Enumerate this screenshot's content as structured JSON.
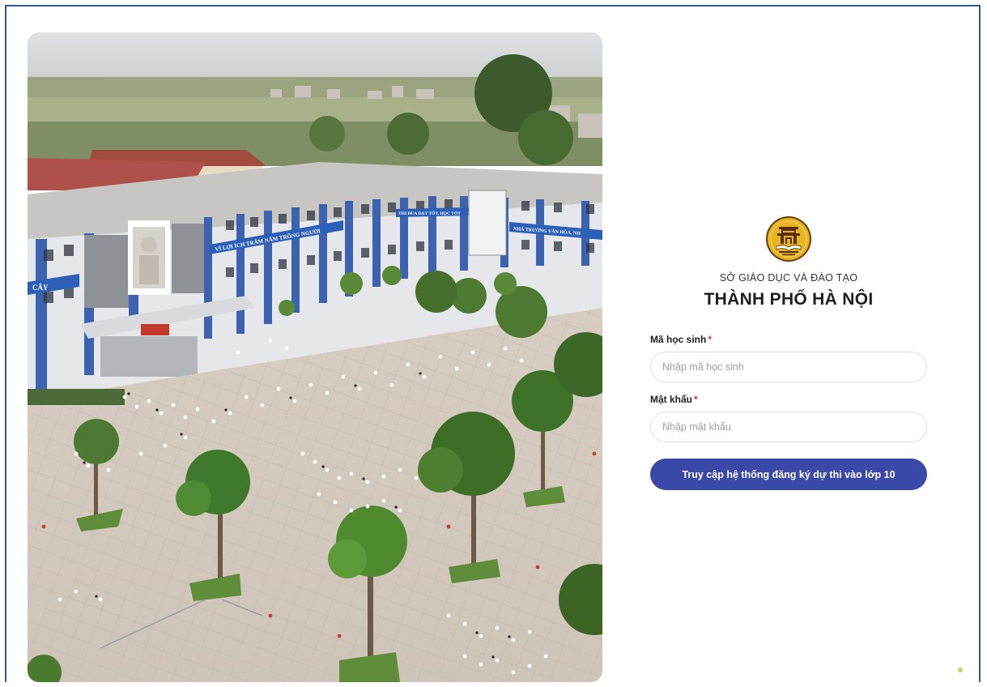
{
  "header": {
    "org_subtitle": "SỞ GIÁO DỤC VÀ ĐÀO TẠO",
    "org_title": "THÀNH PHỐ HÀ NỘI",
    "logo_icon": "hanoi-education-emblem-icon"
  },
  "banners": {
    "left": "VÌ LỢI ÍCH TRĂM NĂM TRỒNG NGƯỜI",
    "center": "THI ĐUA DẠY TỐT, HỌC TỐT",
    "right": "NHÀ TRƯỜNG VĂN HÓA, NH",
    "edge": "CÂY"
  },
  "form": {
    "student_id": {
      "label": "Mã học sinh",
      "required_mark": "*",
      "placeholder": "Nhập mã học sinh",
      "value": ""
    },
    "password": {
      "label": "Mật khẩu",
      "required_mark": "*",
      "placeholder": "Nhập mật khẩu",
      "value": ""
    },
    "submit_label": "Truy cập hệ thống đăng ký dự thi vào lớp 10"
  },
  "colors": {
    "primary_button": "#3a48a8",
    "required": "#e0333a",
    "logo_gold": "#e8b520",
    "logo_ring": "#6b3b12"
  }
}
